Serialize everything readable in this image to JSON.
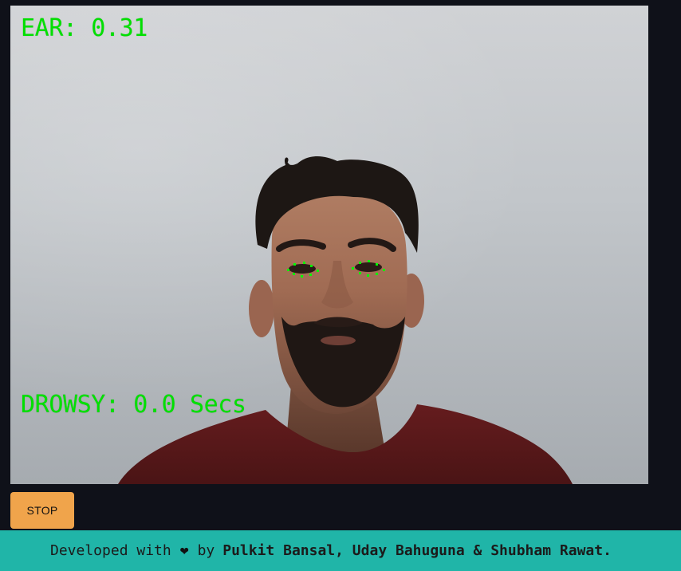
{
  "video": {
    "ear_label": "EAR: 0.31",
    "drowsy_label": "DROWSY: 0.0 Secs",
    "overlay_color": "#00e000"
  },
  "controls": {
    "stop_label": "STOP"
  },
  "footer": {
    "prefix": "Developed with",
    "heart_icon": "heart-icon",
    "by_text": "by",
    "authors": "Pulkit Bansal, Uday Bahuguna & Shubham Rawat.",
    "background_color": "#20b5a8"
  },
  "colors": {
    "page_background": "#0f1119",
    "stop_button": "#f0a44b"
  }
}
